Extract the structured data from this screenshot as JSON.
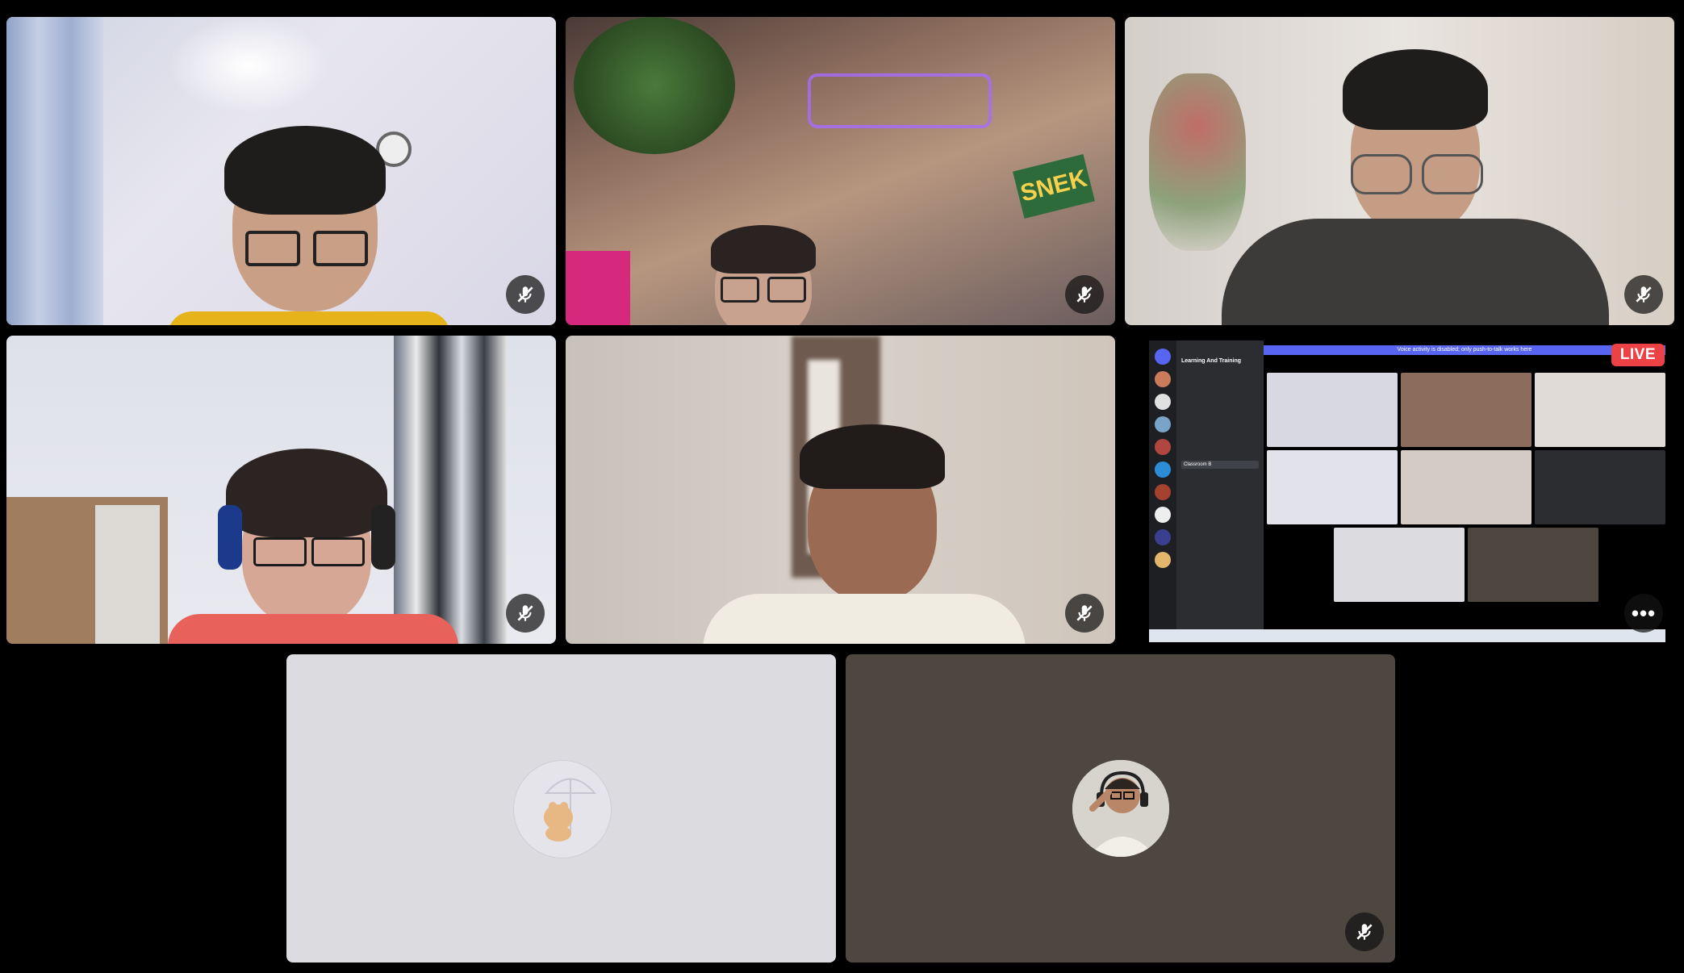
{
  "call": {
    "live_badge": "LIVE",
    "more_label": "•••",
    "mute_icon": "mic-muted-icon"
  },
  "participants": [
    {
      "id": "p1",
      "muted": true,
      "type": "camera"
    },
    {
      "id": "p2",
      "muted": true,
      "type": "camera"
    },
    {
      "id": "p3",
      "muted": true,
      "type": "camera"
    },
    {
      "id": "p4",
      "muted": true,
      "type": "camera"
    },
    {
      "id": "p5",
      "muted": true,
      "type": "camera"
    },
    {
      "id": "p6",
      "muted": false,
      "type": "screen-share",
      "live": true
    },
    {
      "id": "p7",
      "muted": false,
      "type": "avatar",
      "avatar_icon": "umbrella-bear-icon"
    },
    {
      "id": "p8",
      "muted": true,
      "type": "avatar",
      "avatar_icon": "headset-person-icon"
    }
  ],
  "colors": {
    "background": "#000000",
    "live_red": "#ED4245",
    "avatar_tile_light": "#DCDBE0",
    "avatar_tile_dark": "#4E4740",
    "discord_blurple": "#5865F2"
  },
  "shared_screen": {
    "server_name": "Learning And Training",
    "channel": "Classroom B",
    "notice": "Voice activity is disabled; only push-to-talk works here"
  }
}
